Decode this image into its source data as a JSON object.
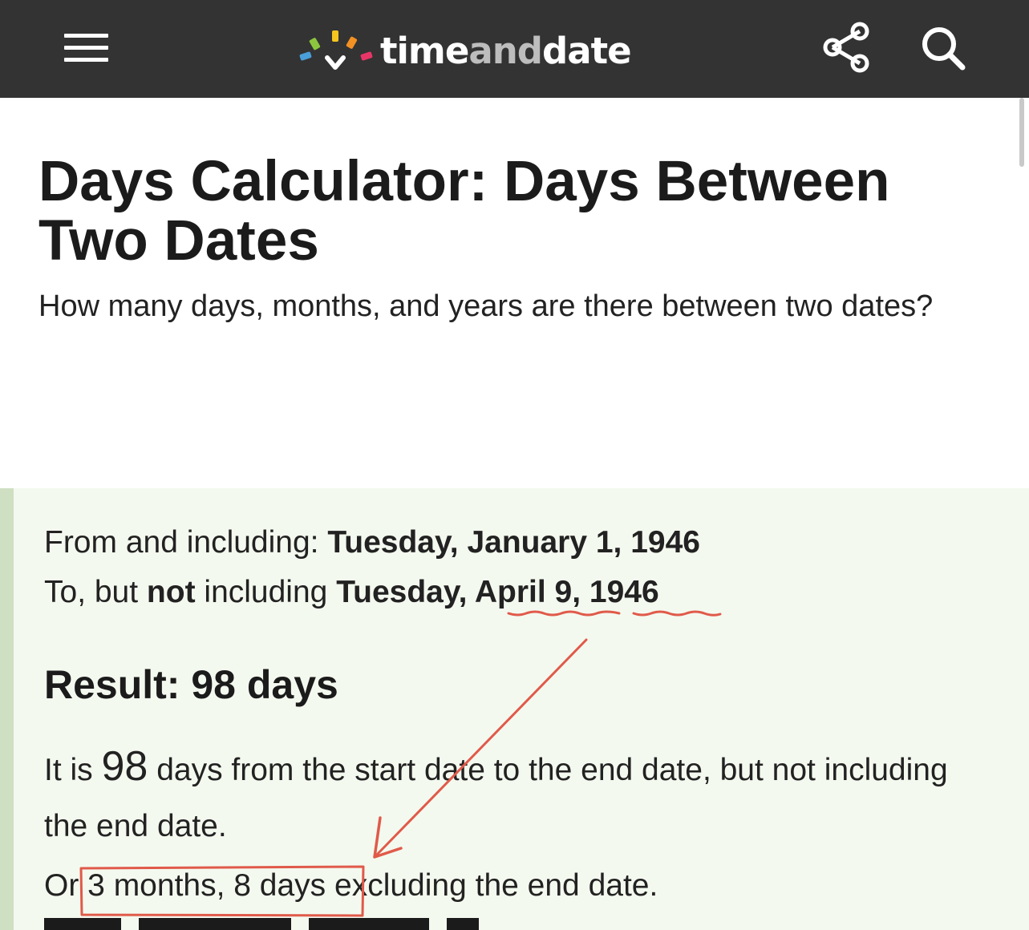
{
  "header": {
    "logo_text_start": "time",
    "logo_text_mid": "and",
    "logo_text_end": "date",
    "menu_icon": "hamburger-menu-icon",
    "share_icon": "share-icon",
    "search_icon": "search-icon",
    "background_color": "#333333"
  },
  "page": {
    "title": "Days Calculator: Days Between Two Dates",
    "subtitle": "How many days, months, and years are there between two dates?"
  },
  "result": {
    "from_prefix": "From and including: ",
    "from_date": "Tuesday, January 1, 1946",
    "to_prefix_1": "To, but ",
    "to_not": "not",
    "to_prefix_2": " including ",
    "to_weekday": "Tuesday, ",
    "to_month_day": "April 9,",
    "to_year": "1946",
    "heading": "Result: 98 days",
    "sentence_start": "It is ",
    "days_number": "98",
    "sentence_end": " days from the start date to the end date, but not including the end date.",
    "alt_prefix": "Or ",
    "alt_value": "3 months, 8 days",
    "alt_suffix": " excluding the end date.",
    "background_color": "#f4f9ef",
    "accent_color": "#cfe0c2"
  },
  "annotation": {
    "color": "#e05a4a"
  }
}
